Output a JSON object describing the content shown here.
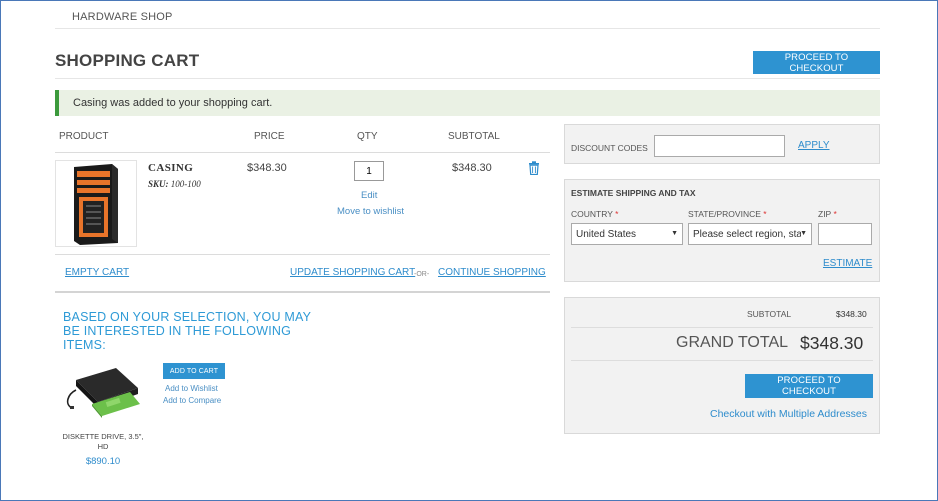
{
  "header": {
    "store_name": "HARDWARE SHOP"
  },
  "page": {
    "title": "SHOPPING CART",
    "checkout_top_label": "PROCEED TO CHECKOUT"
  },
  "message": {
    "text": "Casing was added to your shopping cart."
  },
  "table": {
    "headers": {
      "product": "PRODUCT",
      "price": "PRICE",
      "qty": "QTY",
      "subtotal": "SUBTOTAL"
    },
    "items": [
      {
        "name": "CASING",
        "sku_label": "SKU:",
        "sku": "100-100",
        "price": "$348.30",
        "qty": "1",
        "subtotal": "$348.30",
        "edit": "Edit",
        "move": "Move to wishlist"
      }
    ]
  },
  "actions": {
    "empty": "EMPTY CART",
    "update": "UPDATE SHOPPING CART",
    "or": "-OR-",
    "continue": "CONTINUE SHOPPING"
  },
  "crosssell": {
    "heading": "BASED ON YOUR SELECTION, YOU MAY BE INTERESTED IN THE FOLLOWING ITEMS:",
    "item": {
      "name": "DISKETTE DRIVE, 3.5\", HD",
      "price": "$890.10",
      "add_to_cart": "ADD TO CART",
      "add_wishlist": "Add to Wishlist",
      "add_compare": "Add to Compare"
    }
  },
  "discount": {
    "label": "DISCOUNT CODES",
    "value": "",
    "apply": "APPLY"
  },
  "shipping": {
    "title": "ESTIMATE SHIPPING AND TAX",
    "country_label": "COUNTRY",
    "country_value": "United States",
    "state_label": "STATE/PROVINCE",
    "state_value": "Please select region, state",
    "zip_label": "ZIP",
    "zip_value": "",
    "required": "*",
    "estimate": "ESTIMATE"
  },
  "totals": {
    "subtotal_label": "SUBTOTAL",
    "subtotal_value": "$348.30",
    "grand_label": "GRAND TOTAL",
    "grand_value": "$348.30",
    "checkout_label": "PROCEED TO CHECKOUT",
    "multi_label": "Checkout with Multiple Addresses"
  },
  "colors": {
    "accent": "#2e93d1",
    "link": "#2e8ccc",
    "success_bar": "#3c9a3c",
    "message_bg": "#eaf1e4"
  },
  "icons": {
    "remove": "trash-icon"
  }
}
